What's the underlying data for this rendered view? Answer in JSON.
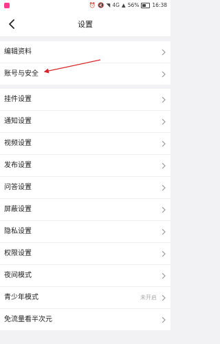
{
  "status_bar": {
    "battery_percent": "56%",
    "time": "16:38",
    "network": "4G"
  },
  "header": {
    "title": "设置"
  },
  "groups": [
    {
      "items": [
        {
          "label": "编辑资料"
        },
        {
          "label": "账号与安全"
        }
      ]
    },
    {
      "items": [
        {
          "label": "挂件设置"
        },
        {
          "label": "通知设置"
        },
        {
          "label": "视频设置"
        },
        {
          "label": "发布设置"
        },
        {
          "label": "问答设置"
        },
        {
          "label": "屏蔽设置"
        },
        {
          "label": "隐私设置"
        },
        {
          "label": "权限设置"
        },
        {
          "label": "夜间模式"
        },
        {
          "label": "青少年模式",
          "value": "未开启"
        },
        {
          "label": "免流量看半次元"
        }
      ]
    }
  ],
  "colors": {
    "annotation_arrow": "#d8242a",
    "accent_badge": "#ff3b8e"
  }
}
